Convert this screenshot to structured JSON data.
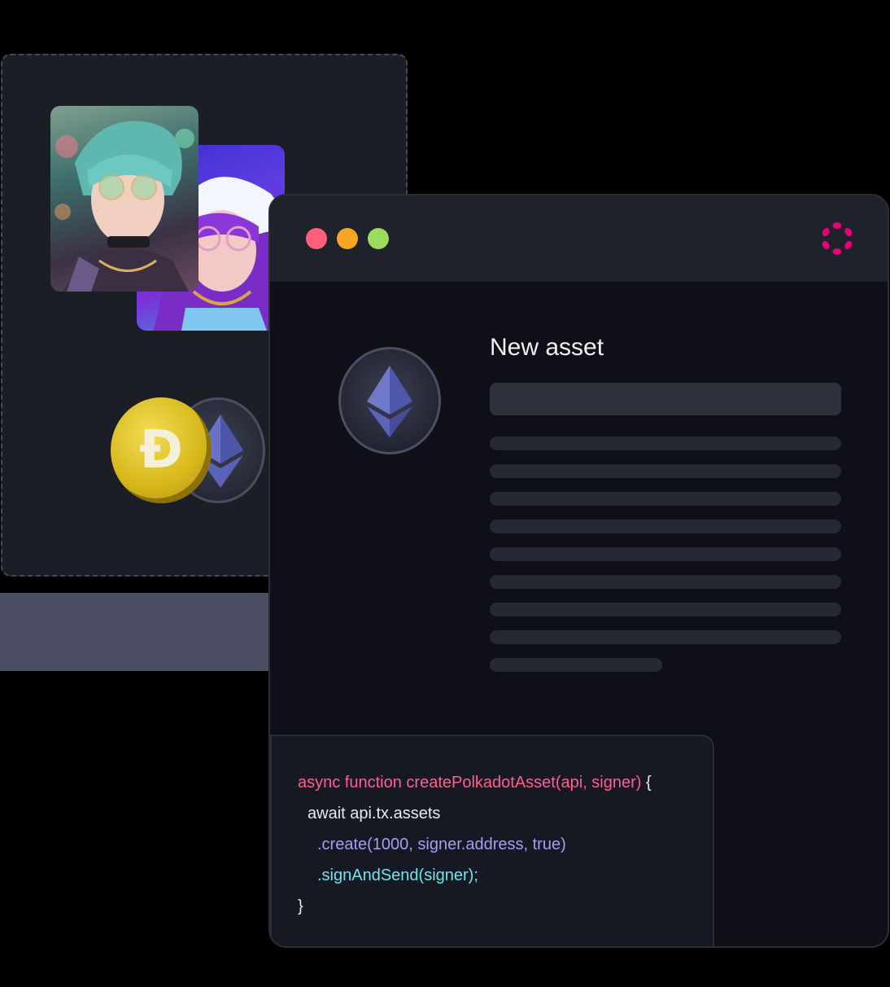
{
  "colors": {
    "code_pink": "#ff5f8f",
    "code_white": "#e8e8ee",
    "code_purple": "#a79cf5",
    "code_cyan": "#6fe3f0",
    "logo_pink": "#e6007a"
  },
  "background_panel": {
    "avatars": [
      "avatar-cyberpunk-boy",
      "avatar-purple-hair-girl"
    ],
    "coins": [
      {
        "name": "dogecoin",
        "symbol": "Ð"
      },
      {
        "name": "ethereum",
        "symbol": "ethereum-icon"
      }
    ]
  },
  "window": {
    "traffic_lights": [
      "close",
      "minimize",
      "maximize"
    ],
    "logo": "polkadot-logo",
    "asset_icon": "ethereum-coin",
    "title": "New asset",
    "code": {
      "line1_pink": "async function createPolkadotAsset(api, signer)",
      "line1_brace": " {",
      "line2": "await api.tx.assets",
      "line3": ".create(1000, signer.address, true)",
      "line4": ".signAndSend(signer);",
      "line5": "}"
    }
  }
}
